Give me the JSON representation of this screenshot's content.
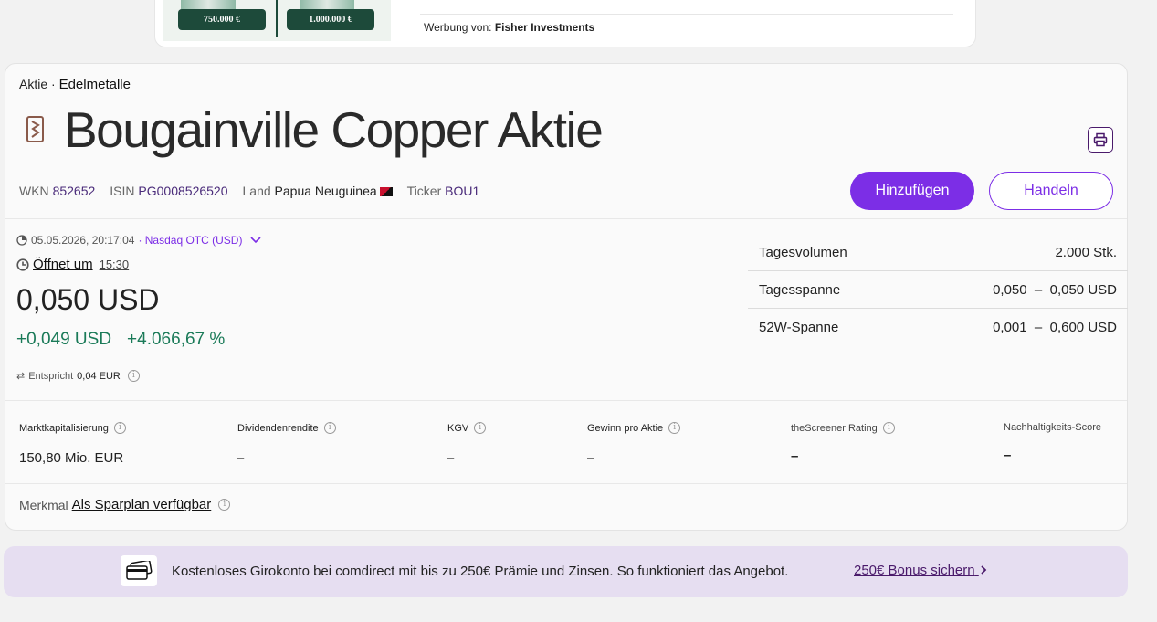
{
  "ad": {
    "pill_left": "750.000 €",
    "pill_right": "1.000.000 €",
    "sponsor_prefix": "Werbung von:",
    "sponsor_name": "Fisher Investments"
  },
  "breadcrumb": {
    "type": "Aktie",
    "separator": "·",
    "sector": "Edelmetalle"
  },
  "title": "Bougainville Copper Aktie",
  "identifiers": {
    "wkn_label": "WKN",
    "wkn_value": "852652",
    "isin_label": "ISIN",
    "isin_value": "PG0008526520",
    "land_label": "Land",
    "land_value": "Papua Neuguinea",
    "ticker_label": "Ticker",
    "ticker_value": "BOU1"
  },
  "buttons": {
    "add": "Hinzufügen",
    "trade": "Handeln"
  },
  "quote": {
    "timestamp": "05.05.2026, 20:17:04",
    "exchange": "· Nasdaq OTC (USD)",
    "opens_label": "Öffnet um",
    "opens_time": "15:30",
    "price": "0,050 USD",
    "change_abs": "+0,049 USD",
    "change_pct": "+4.066,67 %",
    "equivalent_label": "Entspricht",
    "equivalent_value": "0,04 EUR"
  },
  "stats": [
    {
      "label": "Tagesvolumen",
      "value": "2.000 Stk."
    },
    {
      "label": "Tagesspanne",
      "value": "0,050  –  0,050 USD"
    },
    {
      "label": "52W-Spanne",
      "value": "0,001  –  0,600 USD"
    }
  ],
  "kpis": [
    {
      "label": "Marktkapitalisierung",
      "value": "150,80 Mio. EUR"
    },
    {
      "label": "Dividendenrendite",
      "value": "–"
    },
    {
      "label": "KGV",
      "value": "–"
    },
    {
      "label": "Gewinn pro Aktie",
      "value": "–"
    },
    {
      "label": "theScreener Rating",
      "value": "–"
    },
    {
      "label": "Nachhaltigkeits-Score",
      "value": "–"
    }
  ],
  "feature": {
    "label": "Merkmal",
    "link": "Als Sparplan verfügbar"
  },
  "promo": {
    "text": "Kostenloses Girokonto bei comdirect mit bis zu 250€ Prämie und Zinsen. So funktioniert das Angebot.",
    "link": "250€ Bonus sichern"
  },
  "colors": {
    "accent": "#7c2ee6",
    "positive": "#1a7a58",
    "promo_bg": "#e6def1"
  }
}
